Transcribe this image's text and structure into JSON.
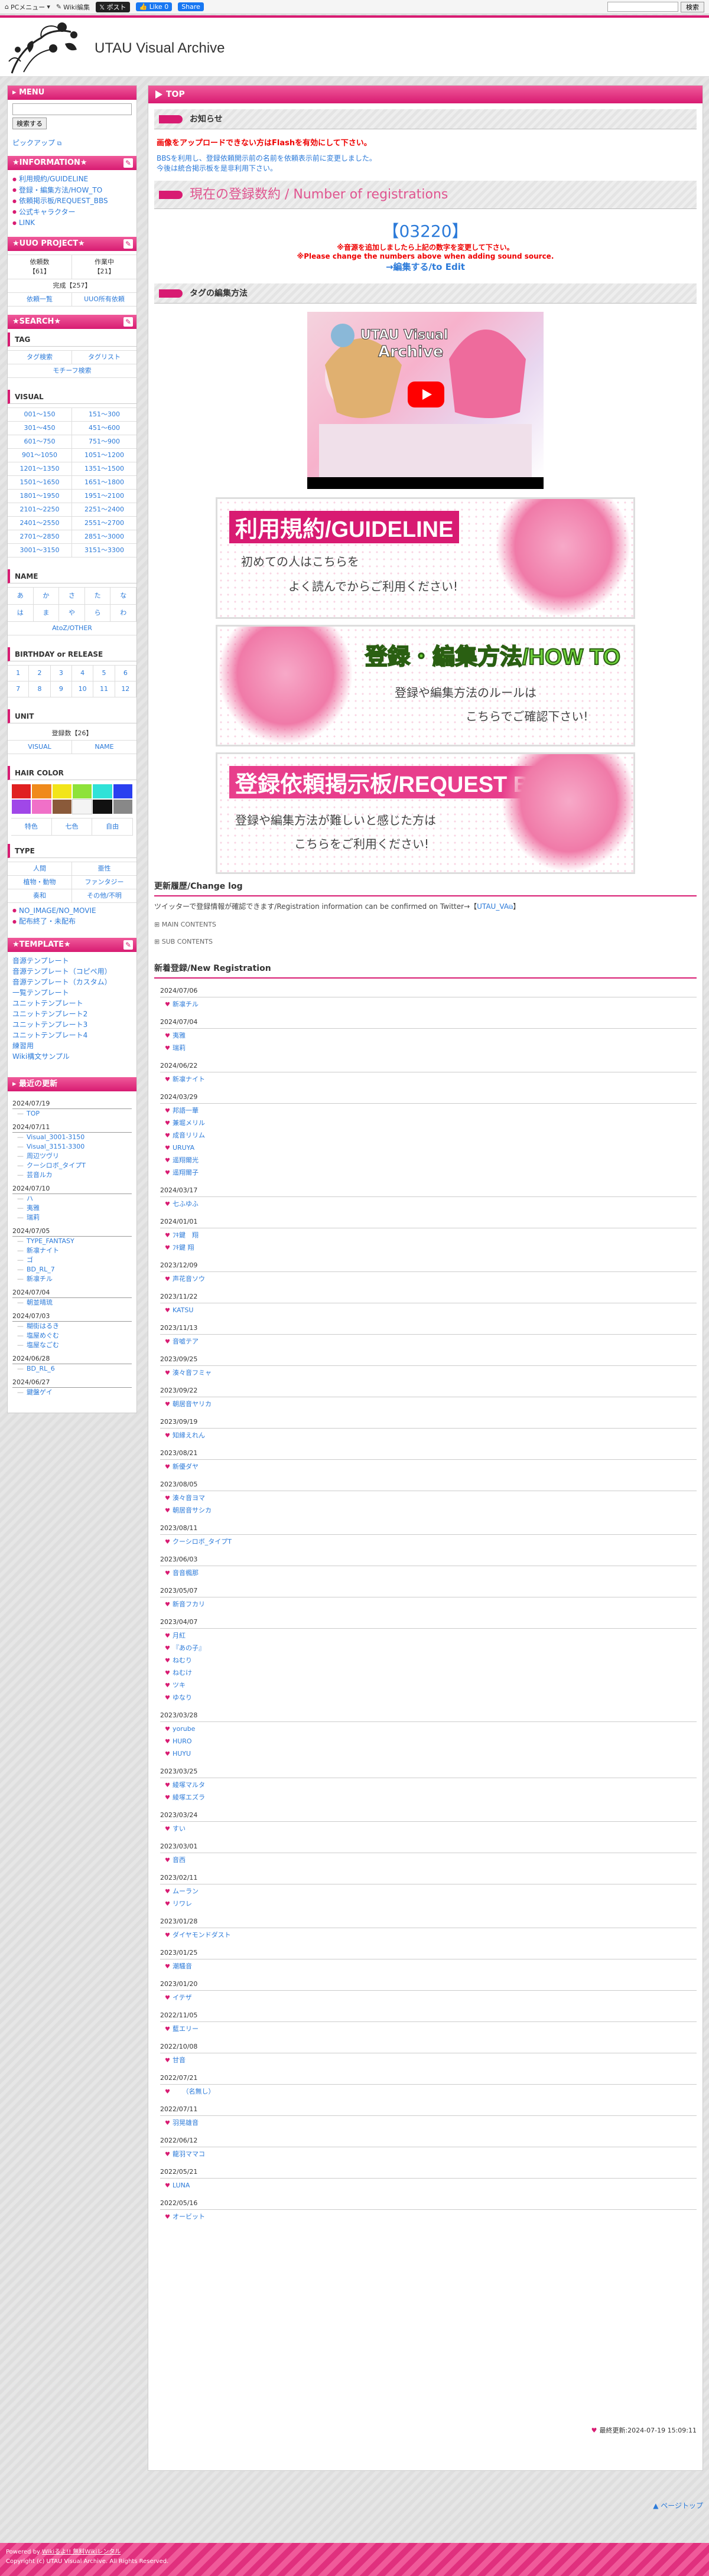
{
  "topbar": {
    "pc_menu": "PCメニュー",
    "wiki_edit": "Wiki編集",
    "post": "ポスト",
    "like": "Like 0",
    "share": "Share",
    "search_button": "検索",
    "search_placeholder": ""
  },
  "site_title": "UTAU Visual Archive",
  "sidebar": {
    "menu_head": "MENU",
    "search_button": "検索する",
    "pickup": "ピックアップ",
    "info_head": "★INFORMATION★",
    "info_links": [
      "利用規約/GUIDELINE",
      "登録・編集方法/HOW_TO",
      "依頼掲示板/REQUEST_BBS",
      "公式キャラクター",
      "LINK"
    ],
    "project_head": "★UUO PROJECT★",
    "project_cells": [
      "依頼数\n【61】",
      "作業中\n【21】"
    ],
    "project_done": "完成【257】",
    "project_links": [
      "依頼一覧",
      "UUO所有依頼"
    ],
    "search_head": "★SEARCH★",
    "tag_head": "TAG",
    "tag_cells": [
      "タグ検索",
      "タグリスト"
    ],
    "tag_full": "モチーフ検索",
    "visual_head": "VISUAL",
    "visual_cells": [
      "001〜150",
      "151〜300",
      "301〜450",
      "451〜600",
      "601〜750",
      "751〜900",
      "901〜1050",
      "1051〜1200",
      "1201〜1350",
      "1351〜1500",
      "1501〜1650",
      "1651〜1800",
      "1801〜1950",
      "1951〜2100",
      "2101〜2250",
      "2251〜2400",
      "2401〜2550",
      "2551〜2700",
      "2701〜2850",
      "2851〜3000",
      "3001〜3150",
      "3151〜3300"
    ],
    "name_head": "NAME",
    "name_cells": [
      "あ",
      "か",
      "さ",
      "た",
      "な",
      "は",
      "ま",
      "や",
      "ら",
      "わ"
    ],
    "name_full": "AtoZ/OTHER",
    "birth_head": "BIRTHDAY or RELEASE",
    "birth_cells": [
      "1",
      "2",
      "3",
      "4",
      "5",
      "6",
      "7",
      "8",
      "9",
      "10",
      "11",
      "12"
    ],
    "unit_head": "UNIT",
    "unit_count": "登録数【26】",
    "unit_cells": [
      "VISUAL",
      "NAME"
    ],
    "hair_head": "HAIR COLOR",
    "hair_colors": [
      "#e02020",
      "#f08a1c",
      "#f2e51a",
      "#8ee23a",
      "#2fe2d8",
      "#2a3ff0",
      "#a047e8",
      "#f070c8",
      "#8a5a3a",
      "#f4f4f4",
      "#111111",
      "#888888"
    ],
    "hair_text": [
      "特色",
      "七色",
      "自由"
    ],
    "type_head": "TYPE",
    "type_cells": [
      "人間",
      "亜性",
      "植物・動物",
      "ファンタジー",
      "奏和",
      "その他/不明"
    ],
    "type_links": [
      "NO_IMAGE/NO_MOVIE",
      "配布終了・未配布"
    ],
    "template_head": "★TEMPLATE★",
    "template_links": [
      "音源テンプレート",
      "音源テンプレート（コピペ用）",
      "音源テンプレート（カスタム）",
      "一覧テンプレート",
      "ユニットテンプレート",
      "ユニットテンプレート2",
      "ユニットテンプレート3",
      "ユニットテンプレート4",
      "練習用",
      "Wiki構文サンプル"
    ],
    "updates_head": "最近の更新",
    "updates": [
      {
        "date": "2024/07/19",
        "items": [
          "TOP"
        ]
      },
      {
        "date": "2024/07/11",
        "items": [
          "Visual_3001-3150",
          "Visual_3151-3300",
          "周辺ツヴリ",
          "クーシロボ_タイプT",
          "芸音ルカ"
        ]
      },
      {
        "date": "2024/07/10",
        "items": [
          "ハ",
          "夷雅",
          "瑞莉"
        ]
      },
      {
        "date": "2024/07/05",
        "items": [
          "TYPE_FANTASY",
          "新凛ナイト",
          "ゴ",
          "BD_RL_7",
          "新凛チル"
        ]
      },
      {
        "date": "2024/07/04",
        "items": [
          "朝並晴琉"
        ]
      },
      {
        "date": "2024/07/03",
        "items": [
          "糊街はるき",
          "塩屋めぐむ",
          "塩屋なごむ"
        ]
      },
      {
        "date": "2024/06/28",
        "items": [
          "BD_RL_6"
        ]
      },
      {
        "date": "2024/06/27",
        "items": [
          "鍵盤ゲイ"
        ]
      }
    ]
  },
  "main": {
    "top_head": "TOP",
    "notice_head": "お知らせ",
    "notice_red": "画像をアップロードできない方はFlashを有効にして下さい。",
    "notice_blue": [
      "BBSを利用し、登録依頼開示前の名前を依頼表示前に変更しました。",
      "今後は統合掲示板を是非利用下さい。"
    ],
    "count_head": "現在の登録数約 / Number of registrations",
    "count_value": "【03220】",
    "count_note_jp": "※音源を追加しましたら上記の数字を変更して下さい。",
    "count_note_en": "※Please change the numbers above when adding sound source.",
    "edit_link": "→編集する/to Edit",
    "tag_edit_head": "タグの編集方法",
    "banners": [
      {
        "title": "利用規約/GUIDELINE",
        "sub1": "初めての人はこちらを",
        "sub2": "よく読んでからご利用ください!"
      },
      {
        "title": "登録・編集方法/HOW TO",
        "sub1": "登録や編集方法のルールは",
        "sub2": "こちらでご確認下さい!"
      },
      {
        "title": "登録依頼掲示板/REQUEST BBS",
        "sub1": "登録や編集方法が難しいと感じた方は",
        "sub2": "こちらをご利用ください!"
      }
    ],
    "changelog_head": "更新履歴/Change log",
    "changelog_line_a": "ツイッターで登録情報が確認できます/Registration information can be confirmed on Twitter→【",
    "changelog_link": "UTAU_VA",
    "changelog_line_b": "】",
    "main_contents": "⊞ MAIN CONTENTS",
    "sub_contents": "⊞ SUB CONTENTS",
    "newreg_head": "新着登録/New Registration",
    "registrations": [
      {
        "date": "2024/07/06",
        "items": [
          "新凛チル"
        ]
      },
      {
        "date": "2024/07/04",
        "items": [
          "夷雅",
          "瑞莉"
        ]
      },
      {
        "date": "2024/06/22",
        "items": [
          "新凛ナイト"
        ]
      },
      {
        "date": "2024/03/29",
        "items": [
          "邦語一華",
          "兼堀メリル",
          "成音リリム",
          "URUYA",
          "遥翔爾光",
          "遥翔爾子"
        ]
      },
      {
        "date": "2024/03/17",
        "items": [
          "七ふゆふ"
        ]
      },
      {
        "date": "2024/01/01",
        "items": [
          "ﾌｷ鍵　翔",
          "ﾌｷ鍵 翔"
        ]
      },
      {
        "date": "2023/12/09",
        "items": [
          "声花音ソウ"
        ]
      },
      {
        "date": "2023/11/22",
        "items": [
          "KATSU"
        ]
      },
      {
        "date": "2023/11/13",
        "items": [
          "音嘘テア"
        ]
      },
      {
        "date": "2023/09/25",
        "items": [
          "湊々音フミャ"
        ]
      },
      {
        "date": "2023/09/22",
        "items": [
          "朝居音ヤリカ"
        ]
      },
      {
        "date": "2023/09/19",
        "items": [
          "知縁えれん"
        ]
      },
      {
        "date": "2023/08/21",
        "items": [
          "新優ダヤ"
        ]
      },
      {
        "date": "2023/08/05",
        "items": [
          "湊々音ヨマ",
          "朝居音サシカ"
        ]
      },
      {
        "date": "2023/08/11",
        "items": [
          "クーシロボ_タイプT"
        ]
      },
      {
        "date": "2023/06/03",
        "items": [
          "音音楓那"
        ]
      },
      {
        "date": "2023/05/07",
        "items": [
          "新音フカリ"
        ]
      },
      {
        "date": "2023/04/07",
        "items": [
          "月紅",
          "『あの子』",
          "ねむり",
          "ねむけ",
          "ツキ",
          "ゆなり"
        ]
      },
      {
        "date": "2023/03/28",
        "items": [
          "yorube",
          "HURO",
          "HUYU"
        ]
      },
      {
        "date": "2023/03/25",
        "items": [
          "綾塚マルタ",
          "綾塚エズラ"
        ]
      },
      {
        "date": "2023/03/24",
        "items": [
          "すい"
        ]
      },
      {
        "date": "2023/03/01",
        "items": [
          "音西"
        ]
      },
      {
        "date": "2023/02/11",
        "items": [
          "ムーラン",
          "リワレ"
        ]
      },
      {
        "date": "2023/01/28",
        "items": [
          "ダイヤモンドダスト"
        ]
      },
      {
        "date": "2023/01/25",
        "items": [
          "潮騒音"
        ]
      },
      {
        "date": "2023/01/20",
        "items": [
          "イテザ"
        ]
      },
      {
        "date": "2022/11/05",
        "items": [
          "藍エリー"
        ]
      },
      {
        "date": "2022/10/08",
        "items": [
          "甘音"
        ]
      },
      {
        "date": "2022/07/21",
        "items": [
          "　　（名無し）"
        ]
      },
      {
        "date": "2022/07/11",
        "items": [
          "羽晃雄音"
        ]
      },
      {
        "date": "2022/06/12",
        "items": [
          "龍羽ママコ"
        ]
      },
      {
        "date": "2022/05/21",
        "items": [
          "LUNA"
        ]
      },
      {
        "date": "2022/05/16",
        "items": [
          "オービット"
        ]
      }
    ],
    "last_update": "最終更新:2024-07-19 15:09:11"
  },
  "pagetop": "▲ ページトップ",
  "footer": {
    "line1": "Powered by ",
    "line1_link": "Wikiるよ!! 無料Wikiレンタル",
    "line2": "Copyright (c) UTAU Visual Archive. All Rights Reserved."
  }
}
